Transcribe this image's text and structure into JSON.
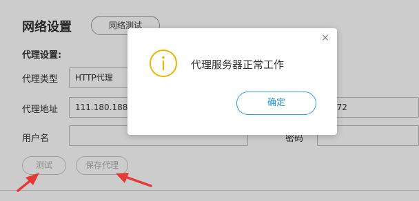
{
  "page": {
    "title": "网络设置",
    "network_test_label": "网络测试",
    "proxy_section_label": "代理设置:",
    "proxy_type_label": "代理类型",
    "proxy_type_value": "HTTP代理",
    "proxy_address_label": "代理地址",
    "proxy_address_value": "111.180.188.2",
    "proxy_port_value": "372",
    "username_label": "用户名",
    "password_label": "密码",
    "test_button_label": "测试",
    "save_proxy_button_label": "保存代理"
  },
  "dialog": {
    "message": "代理服务器正常工作",
    "ok_label": "确定",
    "close_glyph": "×",
    "icon": "info-icon"
  },
  "colors": {
    "accent": "#1e90d8",
    "info_icon": "#f0b400",
    "annotation_arrow": "#e53935"
  }
}
